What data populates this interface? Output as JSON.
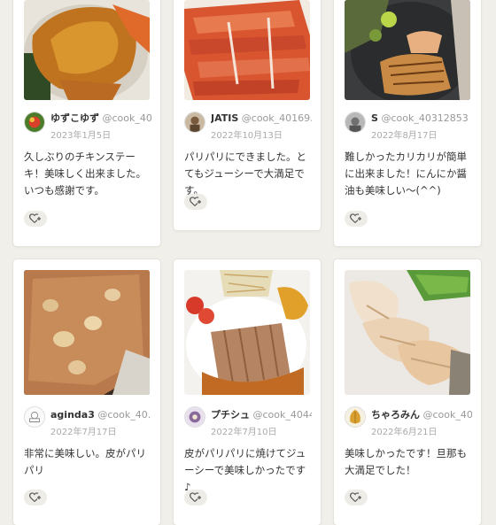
{
  "posts": [
    {
      "username": "ゆずこゆず",
      "handle": "@cook_40...",
      "date": "2023年1月5日",
      "comment": "久しぶりのチキンステーキ！美味しく出来ました。いつも感謝です。"
    },
    {
      "username": "JATIS",
      "handle": "@cook_40169...",
      "date": "2022年10月13日",
      "comment": "パリパリにできました。とてもジューシーで大満足です。"
    },
    {
      "username": "S",
      "handle": "@cook_40312853",
      "date": "2022年8月17日",
      "comment": "難しかったカリカリが簡単に出来ました！にんにか醤油も美味しい〜(^^)"
    },
    {
      "username": "aginda3",
      "handle": "@cook_40...",
      "date": "2022年7月17日",
      "comment": "非常に美味しい。皮がパリパリ"
    },
    {
      "username": "プチシュ",
      "handle": "@cook_4044...",
      "date": "2022年7月10日",
      "comment": "皮がパリパリに焼けてジューシーで美味しかったです♪"
    },
    {
      "username": "ちゃろみん",
      "handle": "@cook_40...",
      "date": "2022年6月21日",
      "comment": "美味しかったです！旦那も大満足でした！"
    }
  ],
  "icons": {
    "like": "heart-plus-icon"
  }
}
